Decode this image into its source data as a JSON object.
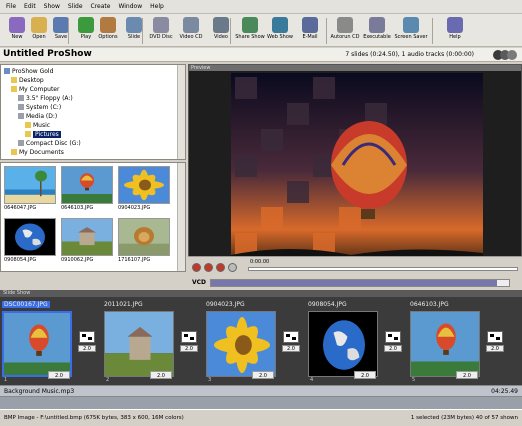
{
  "menu": [
    "File",
    "Edit",
    "Show",
    "Slide",
    "Create",
    "Window",
    "Help"
  ],
  "toolbar": [
    {
      "label": "New",
      "icon": "new-show-icon",
      "color": "#8a6abf"
    },
    {
      "label": "Open",
      "icon": "open-folder-icon",
      "color": "#d8b050"
    },
    {
      "label": "Save",
      "icon": "save-disk-icon",
      "color": "#5a7ab0"
    },
    {
      "label": "Play",
      "icon": "play-icon",
      "color": "#3b9a3b"
    },
    {
      "label": "Options",
      "icon": "options-icon",
      "color": "#b07a40"
    },
    {
      "label": "Slide",
      "icon": "slide-icon",
      "color": "#6a8ab0"
    },
    {
      "label": "DVD Disc",
      "icon": "dvd-disc-icon",
      "color": "#8a8aa0"
    },
    {
      "label": "Video CD",
      "icon": "video-cd-icon",
      "color": "#7a8aa0"
    },
    {
      "label": "Video",
      "icon": "video-icon",
      "color": "#6a7a8a"
    },
    {
      "label": "Share Show",
      "icon": "share-show-icon",
      "color": "#4a8a5a"
    },
    {
      "label": "Web Show",
      "icon": "web-show-icon",
      "color": "#3a7a9a"
    },
    {
      "label": "E-Mail",
      "icon": "email-icon",
      "color": "#5a6a9a"
    },
    {
      "label": "Autorun CD",
      "icon": "autorun-cd-icon",
      "color": "#8a8a8a"
    },
    {
      "label": "Executable",
      "icon": "executable-icon",
      "color": "#7a7a9a"
    },
    {
      "label": "Screen Saver",
      "icon": "screen-saver-icon",
      "color": "#5a8ab0"
    },
    {
      "label": "Help",
      "icon": "help-icon",
      "color": "#6a6ab0"
    }
  ],
  "title": "Untitled ProShow",
  "show_summary": "7 slides (0:24.50), 1 audio tracks (0:00:00)",
  "tree": {
    "root": "ProShow Gold",
    "items": [
      {
        "label": "Desktop",
        "level": 1
      },
      {
        "label": "My Computer",
        "level": 1
      },
      {
        "label": "3.5\" Floppy (A:)",
        "level": 2
      },
      {
        "label": "System (C:)",
        "level": 2
      },
      {
        "label": "Media (D:)",
        "level": 2
      },
      {
        "label": "Music",
        "level": 3
      },
      {
        "label": "Pictures",
        "level": 3,
        "selected": true
      },
      {
        "label": "Compact Disc (G:)",
        "level": 2
      },
      {
        "label": "My Documents",
        "level": 1
      }
    ]
  },
  "file_thumbs": [
    {
      "name": "0646047.JPG",
      "kind": "beach"
    },
    {
      "name": "0646103.JPG",
      "kind": "balloon"
    },
    {
      "name": "0904023.JPG",
      "kind": "sunflower"
    },
    {
      "name": "0908054.JPG",
      "kind": "earth"
    },
    {
      "name": "0910062.JPG",
      "kind": "building"
    },
    {
      "name": "1716107.JPG",
      "kind": "lion"
    }
  ],
  "preview": {
    "header": "Preview",
    "time": "0:00.00",
    "vcd_label": "VCD",
    "vcd_fill": 0.96
  },
  "slides_header": "Slide Show",
  "slides": [
    {
      "name": "DSC00167.JPG",
      "kind": "balloon",
      "num": "1",
      "dur": "2.0",
      "selected": true
    },
    {
      "name": "2011021.JPG",
      "kind": "building",
      "num": "2",
      "dur": "2.0"
    },
    {
      "name": "0904023.JPG",
      "kind": "sunflower",
      "num": "3",
      "dur": "2.0"
    },
    {
      "name": "0908054.JPG",
      "kind": "earth",
      "num": "4",
      "dur": "2.0"
    },
    {
      "name": "0646103.JPG",
      "kind": "balloon",
      "num": "5",
      "dur": "2.0"
    }
  ],
  "transitions": [
    "2.0",
    "2.0",
    "2.0",
    "2.0",
    "2.0"
  ],
  "music": {
    "label": "Background Music.mp3",
    "time": "04:25.49"
  },
  "status": {
    "left": "BMP Image - F:\\untitled.bmp  (675K bytes, 383 x 600, 16M colors)",
    "right": "1 selected (23M bytes) 40 of 57 shown"
  },
  "colors": {
    "selection": "#0a246a",
    "accent": "#3a6ee8"
  }
}
